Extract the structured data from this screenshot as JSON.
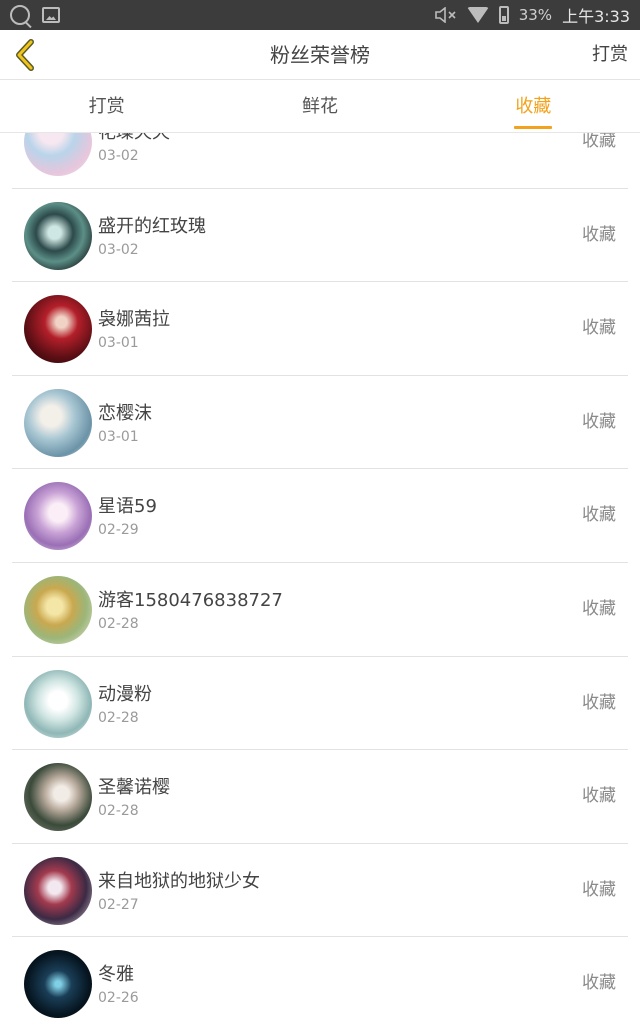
{
  "status_bar": {
    "battery": "33%",
    "time": "上午3:33"
  },
  "header": {
    "title": "粉丝荣誉榜",
    "action_label": "打赏"
  },
  "tabs": [
    {
      "label": "打赏",
      "active": false
    },
    {
      "label": "鲜花",
      "active": false
    },
    {
      "label": "收藏",
      "active": true
    }
  ],
  "colors": {
    "accent": "#f2a21c",
    "status_bar": "#3c3c3c"
  },
  "fans": [
    {
      "name": "花璨天天",
      "date": "03-02",
      "action": "收藏"
    },
    {
      "name": "盛开的红玫瑰",
      "date": "03-02",
      "action": "收藏"
    },
    {
      "name": "袅娜茜拉",
      "date": "03-01",
      "action": "收藏"
    },
    {
      "name": "恋樱沫",
      "date": "03-01",
      "action": "收藏"
    },
    {
      "name": "星语59",
      "date": "02-29",
      "action": "收藏"
    },
    {
      "name": "游客1580476838727",
      "date": "02-28",
      "action": "收藏"
    },
    {
      "name": "动漫粉",
      "date": "02-28",
      "action": "收藏"
    },
    {
      "name": "圣馨诺樱",
      "date": "02-28",
      "action": "收藏"
    },
    {
      "name": "来自地狱的地狱少女",
      "date": "02-27",
      "action": "收藏"
    },
    {
      "name": "冬雅",
      "date": "02-26",
      "action": "收藏"
    }
  ]
}
